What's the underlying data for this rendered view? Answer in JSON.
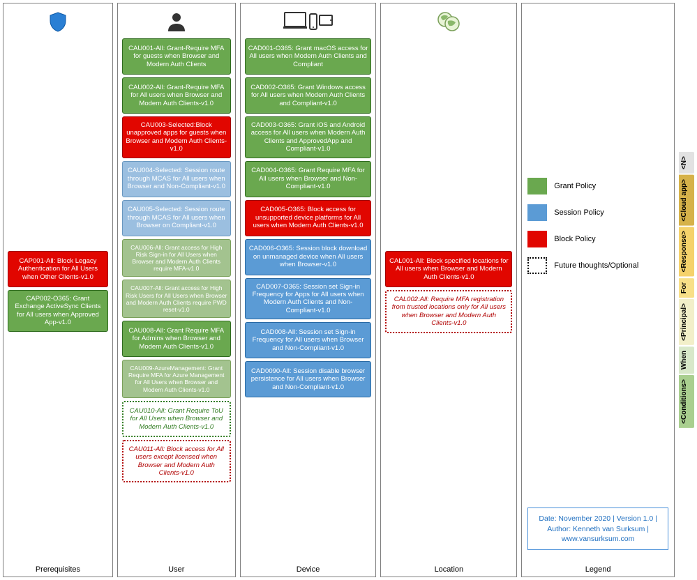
{
  "columns": {
    "prereq": {
      "title": "Prerequisites",
      "cards": {
        "cap001": "CAP001-All: Block Legacy Authentication for All Users when Other Clients-v1.0",
        "cap002": "CAP002-O365: Grant Exchange ActiveSync Clients for All users when Approved App-v1.0"
      }
    },
    "user": {
      "title": "User",
      "cards": {
        "cau001": "CAU001-All: Grant-Require MFA for guests when Browser and Modern Auth Clients",
        "cau002": "CAU002-All: Grant-Require MFA for All users when Browser and Modern Auth Clients-v1.0",
        "cau003": "CAU003-Selected:Block unapproved apps for guests when Browser and Modern Auth Clients-v1.0",
        "cau004": "CAU004-Selected: Session route through MCAS for All users when Browser and Non-Compliant-v1.0",
        "cau005": "CAU005-Selected: Session route through MCAS for All users when Browser on Compliant-v1.0",
        "cau006": "CAU006-All: Grant access for High Risk Sign-in for All Users when Browser and Modern Auth Clients require MFA-v1.0",
        "cau007": "CAU007-All: Grant access for High Risk Users for All Users when Browser and Modern Auth Clients require PWD reset-v1.0",
        "cau008": "CAU008-All: Grant Require MFA for Admins when Browser and Modern Auth Clients-v1.0",
        "cau009": "CAU009-AzureManagement: Grant Require MFA for Azure Management for All Users when Browser and Modern Auth Clients-v1.0",
        "cau010": "CAU010-All: Grant Require ToU for All Users when Browser and Modern Auth Clients-v1.0",
        "cau011": "CAU011-All: Block access for All users except licensed when Browser and Modern Auth Clients-v1.0"
      }
    },
    "device": {
      "title": "Device",
      "cards": {
        "cad001": "CAD001-O365: Grant macOS access for All users when Modern Auth Clients and Compliant",
        "cad002": "CAD002-O365: Grant Windows access for All users when Modern Auth Clients and Compliant-v1.0",
        "cad003": "CAD003-O365: Grant iOS and Android access for All users when Modern Auth Clients and ApprovedApp and Compliant-v1.0",
        "cad004": "CAD004-O365: Grant Require MFA for All users when Browser and Non-Compliant-v1.0",
        "cad005": "CAD005-O365: Block access for unsupported device platforms for All users when Modern Auth Clients-v1.0",
        "cad006": "CAD006-O365: Session block download on unmanaged device when All users when Browser-v1.0",
        "cad007": "CAD007-O365: Session set Sign-in Frequency for Apps for All users when Modern Auth Clients and Non-Compliant-v1.0",
        "cad008": "CAD008-All:  Session set Sign-in Frequency for All users when Browser and Non-Compliant-v1.0",
        "cad009": "CAD0090-All: Session disable browser persistence for All users when Browser and Non-Compliant-v1.0"
      }
    },
    "location": {
      "title": "Location",
      "cards": {
        "cal001": "CAL001-All: Block specified locations for All users when Browser and Modern Auth Clients-v1.0",
        "cal002": "CAL002:All: Require MFA registration from trusted locations only for All users when Browser and Modern Auth Clients-v1.0"
      }
    },
    "legend": {
      "title": "Legend",
      "items": {
        "grant": "Grant Policy",
        "session": "Session Policy",
        "block": "Block Policy",
        "future": "Future thoughts/Optional"
      },
      "meta": {
        "line1": "Date: November 2020 | Version 1.0 |",
        "line2": "Author: Kenneth van Surksum |",
        "line3": "www.vansurksum.com"
      }
    }
  },
  "tabs": {
    "t1": "<N>",
    "t2": "<Cloud app>",
    "t3": "<Response>",
    "t4": "For",
    "t5": "<Principal>",
    "t6": "When",
    "t7": "<Conditions>"
  },
  "colors": {
    "grant": "#6aa84f",
    "block": "#e10600",
    "session": "#5b9bd5"
  }
}
